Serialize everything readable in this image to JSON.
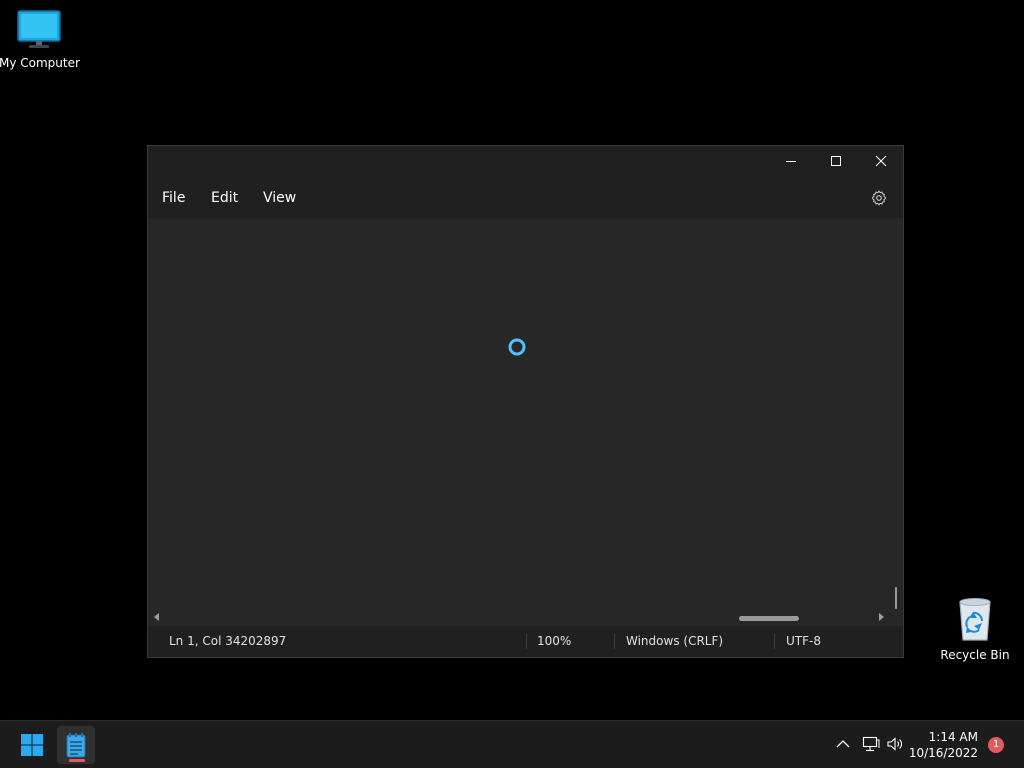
{
  "desktop": {
    "icons": [
      {
        "label": "My Computer",
        "icon": "monitor-icon"
      },
      {
        "label": "Recycle Bin",
        "icon": "recycle-bin-icon"
      }
    ]
  },
  "window": {
    "app": "Notepad",
    "controls": [
      "minimize-icon",
      "maximize-icon",
      "close-icon"
    ],
    "menu": {
      "file": "File",
      "edit": "Edit",
      "view": "View"
    },
    "settings_icon": "gear-icon",
    "loading": true,
    "status": {
      "position": "Ln 1, Col 34202897",
      "zoom": "100%",
      "line_ending": "Windows (CRLF)",
      "encoding": "UTF-8"
    }
  },
  "taskbar": {
    "start_icon": "windows-start-icon",
    "pinned": [
      {
        "app": "Notepad",
        "icon": "notepad-icon",
        "active": true
      }
    ],
    "tray": [
      "chevron-up-icon",
      "network-icon",
      "speaker-icon"
    ],
    "time": "1:14 AM",
    "date": "10/16/2022",
    "notification_count": "1"
  },
  "colors": {
    "accent": "#4cc2ff",
    "window_bg": "#202020",
    "editor_bg": "#272727",
    "taskbar_bg": "#1c1c1c",
    "badge": "#e25a5a"
  }
}
